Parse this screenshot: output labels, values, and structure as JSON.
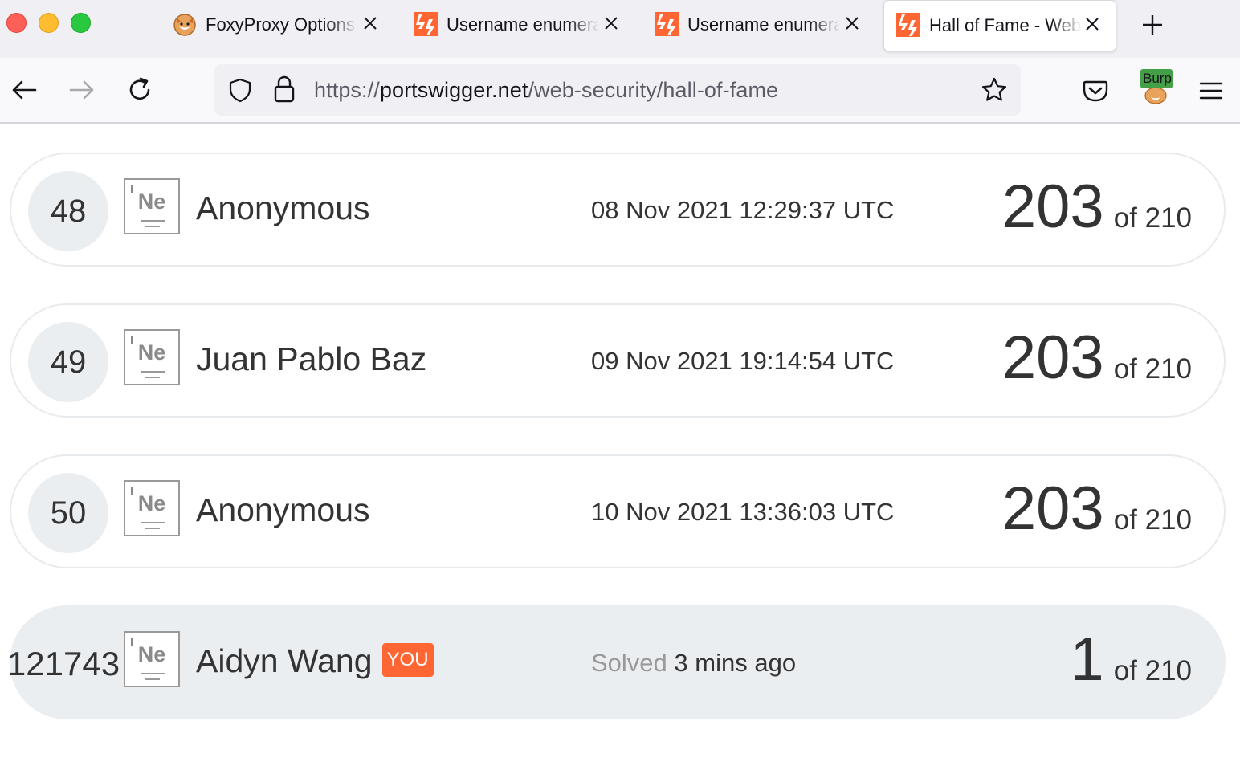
{
  "browser": {
    "tabs": [
      {
        "title": "FoxyProxy Options",
        "icon": "foxyproxy-icon",
        "active": false
      },
      {
        "title": "Username enumeration",
        "icon": "portswigger-icon",
        "active": false
      },
      {
        "title": "Username enumeration",
        "icon": "portswigger-icon",
        "active": false
      },
      {
        "title": "Hall of Fame - Web Security Academy",
        "icon": "portswigger-icon",
        "active": true
      }
    ],
    "url": {
      "scheme": "https://",
      "host": "portswigger.net",
      "path": "/web-security/hall-of-fame"
    },
    "extension_badge": "Burp"
  },
  "colors": {
    "accent": "#ff6633",
    "row_border": "#e8ebee",
    "highlight_bg": "#ebeef1"
  },
  "leaderboard": {
    "element_symbol": "Ne",
    "rows": [
      {
        "rank": "48",
        "name": "Anonymous",
        "date": "08 Nov 2021 12:29:37 UTC",
        "score": "203",
        "of": "of 210"
      },
      {
        "rank": "49",
        "name": "Juan Pablo Baz",
        "date": "09 Nov 2021 19:14:54 UTC",
        "score": "203",
        "of": "of 210"
      },
      {
        "rank": "50",
        "name": "Anonymous",
        "date": "10 Nov 2021 13:36:03 UTC",
        "score": "203",
        "of": "of 210"
      }
    ],
    "you": {
      "rank": "121743",
      "name": "Aidyn Wang",
      "badge": "YOU",
      "solved_label": "Solved",
      "solved_time": "3 mins ago",
      "score": "1",
      "of": "of 210"
    }
  }
}
